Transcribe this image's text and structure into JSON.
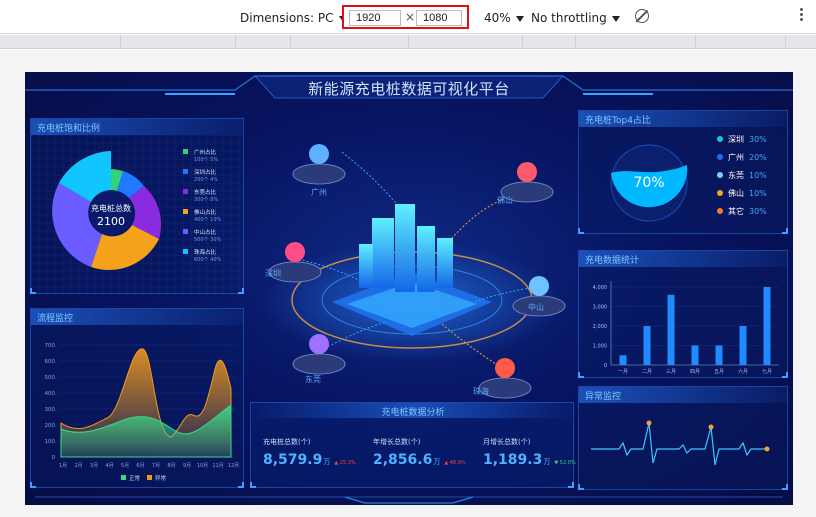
{
  "devtools": {
    "dimensions_label": "Dimensions: PC",
    "width": "1920",
    "height": "1080",
    "times": "×",
    "zoom": "40%",
    "throttling": "No throttling"
  },
  "dashboard": {
    "title": "新能源充电桩数据可视化平台",
    "ratio_panel": {
      "title": "充电桩饱和比例",
      "center_label": "充电桩总数",
      "center_value": "2100",
      "legend": [
        {
          "name": "广州占比",
          "sub": "100个 5%",
          "color": "#34d07a"
        },
        {
          "name": "深圳占比",
          "sub": "200个 4%",
          "color": "#1e7bff"
        },
        {
          "name": "东莞占比",
          "sub": "300个 8%",
          "color": "#8a2be2"
        },
        {
          "name": "佛山占比",
          "sub": "400个 10%",
          "color": "#f4a21c"
        },
        {
          "name": "中山占比",
          "sub": "500个 30%",
          "color": "#6a5cff"
        },
        {
          "name": "珠海占比",
          "sub": "600个 40%",
          "color": "#11c6ff"
        }
      ]
    },
    "flow_panel": {
      "title": "流程监控",
      "yticks": [
        "700",
        "600",
        "500",
        "400",
        "300",
        "200",
        "100",
        "0"
      ],
      "xticks": [
        "1月",
        "2月",
        "3月",
        "4月",
        "5月",
        "6月",
        "7月",
        "8月",
        "9月",
        "10月",
        "11月",
        "12月"
      ],
      "legend": [
        {
          "name": "正常",
          "color": "#38d98a"
        },
        {
          "name": "异常",
          "color": "#f09a1c"
        }
      ]
    },
    "map": {
      "cities": [
        "广州",
        "佛山",
        "深圳",
        "中山",
        "东莞",
        "珠海"
      ]
    },
    "analysis_panel": {
      "title": "充电桩数据分析",
      "stats": [
        {
          "label": "充电桩总数(个)",
          "value": "8,579.9",
          "unit": "万",
          "change": "▲ 25.3%",
          "dir": "up"
        },
        {
          "label": "年增长总数(个)",
          "value": "2,856.6",
          "unit": "万",
          "change": "▲ 48.9%",
          "dir": "up"
        },
        {
          "label": "月增长总数(个)",
          "value": "1,189.3",
          "unit": "万",
          "change": "▼ 52.0%",
          "dir": "down"
        }
      ]
    },
    "top4_panel": {
      "title": "充电桩Top4占比",
      "center_value": "70%",
      "items": [
        {
          "name": "深圳",
          "value": "30%",
          "color": "#1ec8d0"
        },
        {
          "name": "广州",
          "value": "20%",
          "color": "#1e6bff"
        },
        {
          "name": "东莞",
          "value": "10%",
          "color": "#7fd0ff"
        },
        {
          "name": "佛山",
          "value": "10%",
          "color": "#f6a21c"
        },
        {
          "name": "其它",
          "value": "30%",
          "color": "#f07a3a"
        }
      ]
    },
    "count_panel": {
      "title": "充电数据统计",
      "chart_data": {
        "type": "bar",
        "categories": [
          "一月",
          "二月",
          "三月",
          "四月",
          "五月",
          "六月",
          "七月"
        ],
        "values": [
          500,
          2000,
          3600,
          1000,
          1000,
          2000,
          4000
        ],
        "ylim": [
          0,
          4000
        ],
        "yticks": [
          "4,000",
          "3,000",
          "2,000",
          "1,000",
          "0"
        ]
      }
    },
    "alarm_panel": {
      "title": "异常监控"
    }
  }
}
